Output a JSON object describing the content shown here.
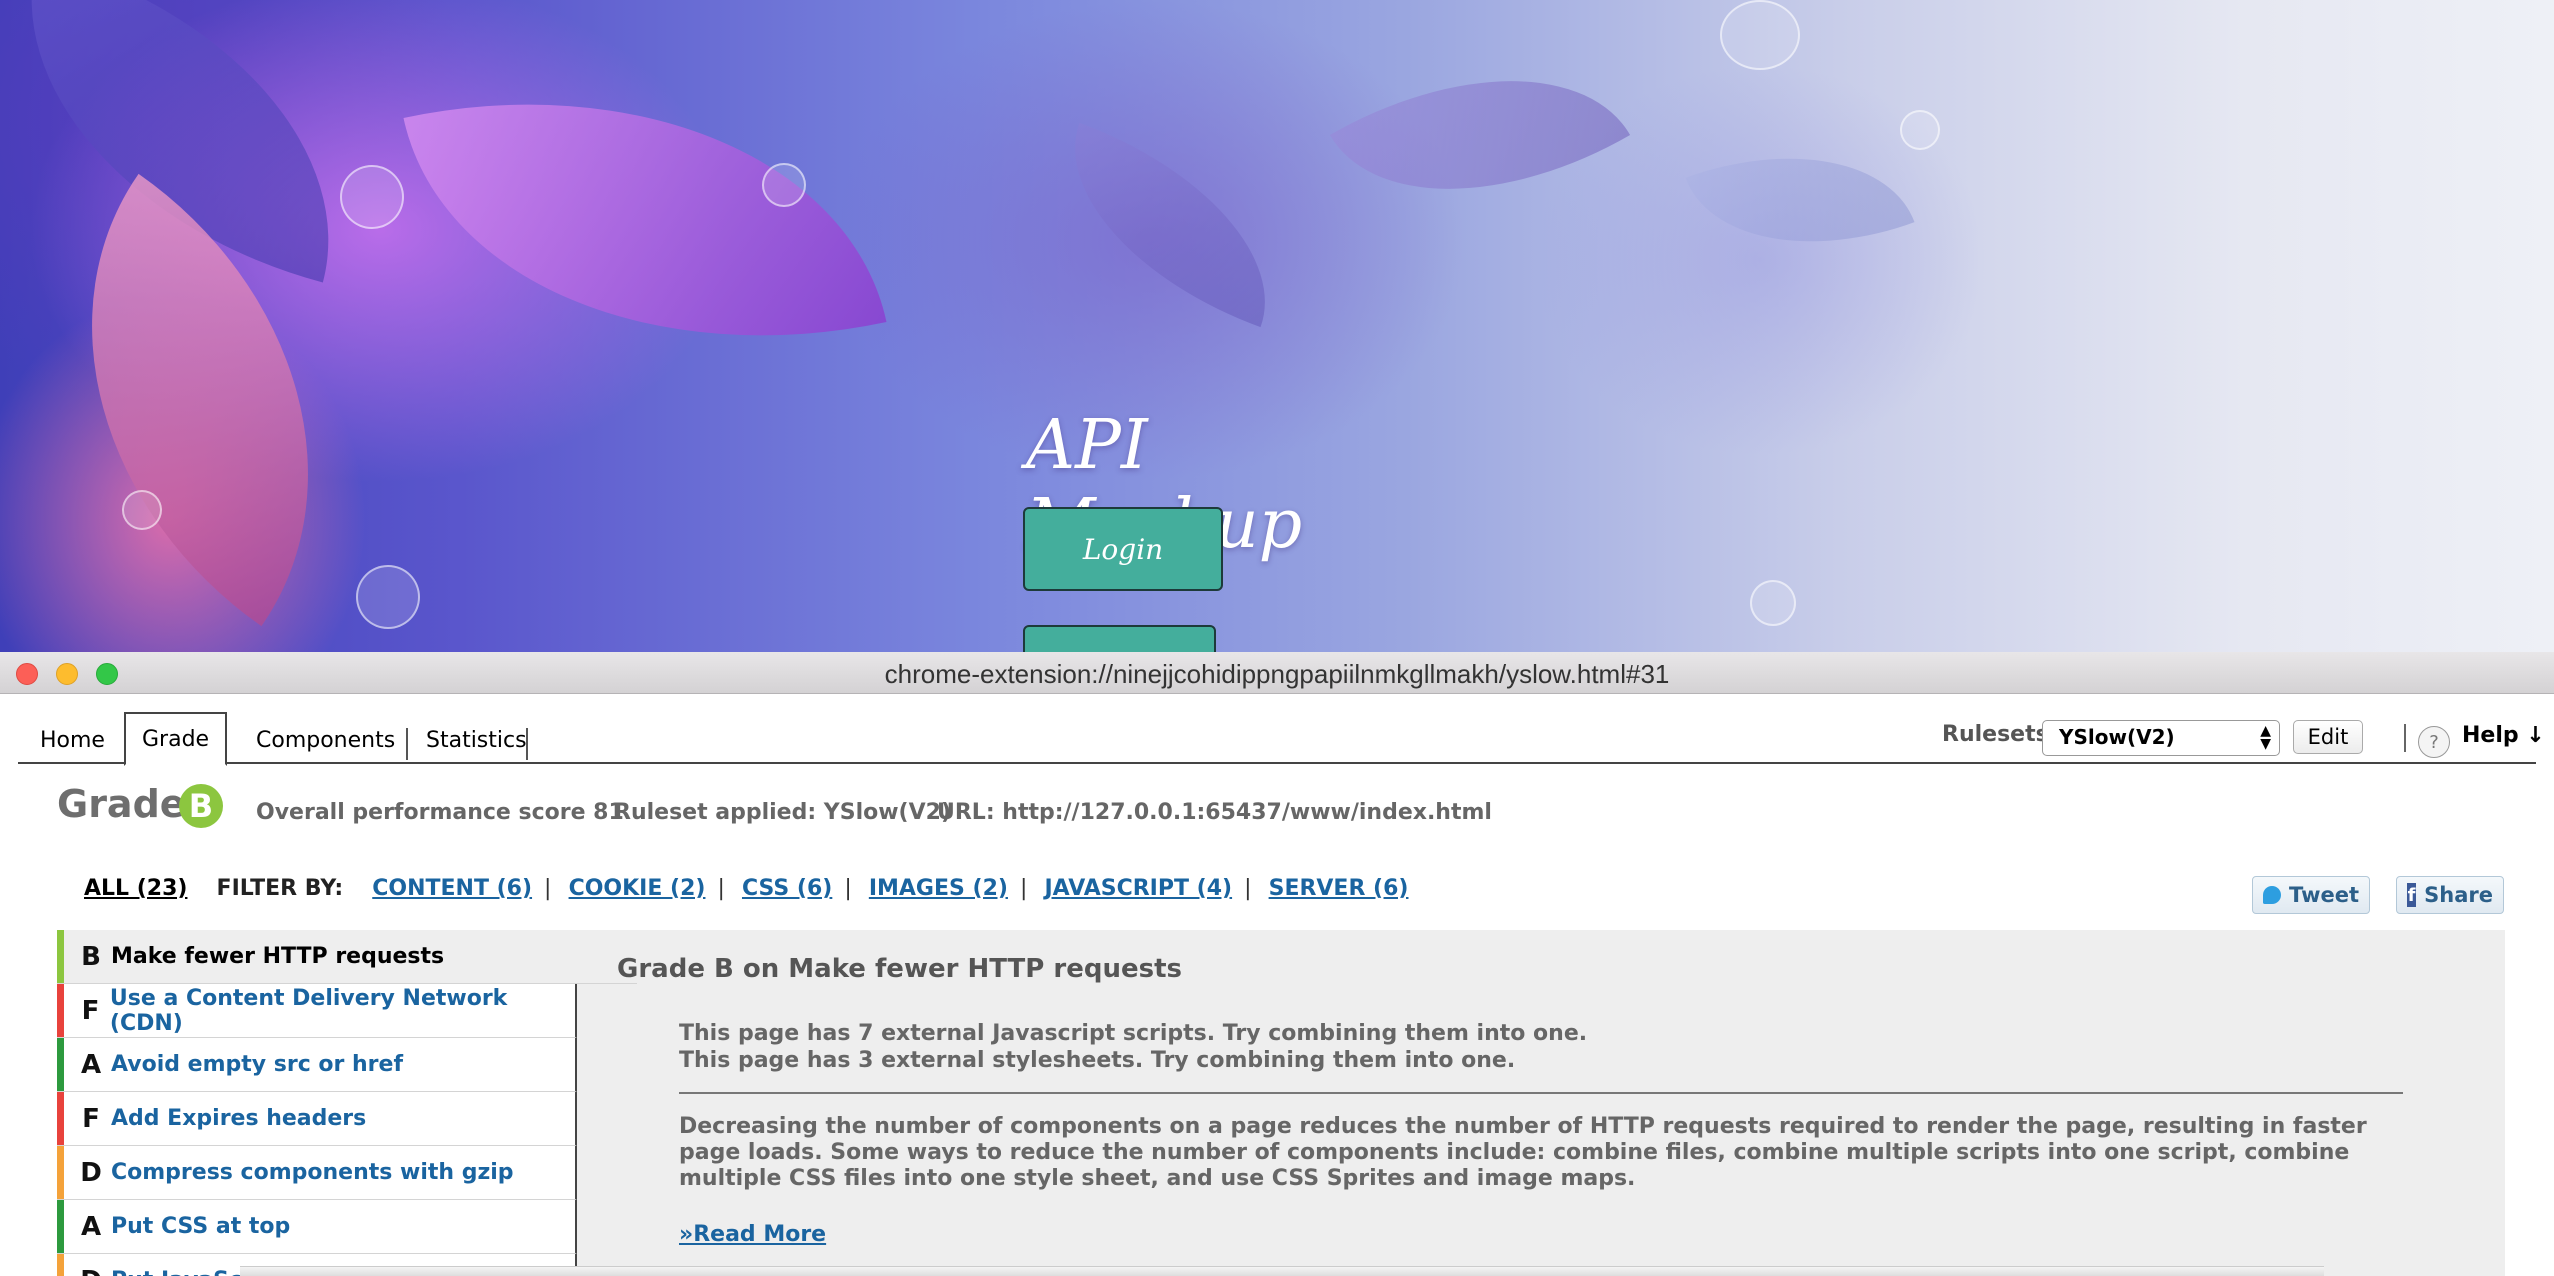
{
  "background_page": {
    "title": "API Mashup",
    "login_label": "Login"
  },
  "window": {
    "url": "chrome-extension://ninejjcohidippngpapiilnmkgllmakh/yslow.html#31"
  },
  "tabs": [
    "Home",
    "Grade",
    "Components",
    "Statistics"
  ],
  "toolbar": {
    "rulesets_label": "Rulesets",
    "ruleset_value": "YSlow(V2)",
    "edit_label": "Edit",
    "help_icon": "?",
    "help_label": "Help ↓"
  },
  "summary": {
    "grade_label": "Grade",
    "grade": "B",
    "score_text": "Overall performance score 81",
    "ruleset_text": "Ruleset applied: YSlow(V2)",
    "url_text": "URL: http://127.0.0.1:65437/www/index.html"
  },
  "filters": {
    "all": "ALL (23)",
    "label": "FILTER BY:",
    "items": [
      "CONTENT (6)",
      "COOKIE (2)",
      "CSS (6)",
      "IMAGES (2)",
      "JAVASCRIPT (4)",
      "SERVER (6)"
    ]
  },
  "share": {
    "tweet": "Tweet",
    "share": "Share"
  },
  "rules": [
    {
      "grade": "B",
      "name": "Make fewer HTTP requests",
      "color": "#8cc63f"
    },
    {
      "grade": "F",
      "name": "Use a Content Delivery Network (CDN)",
      "color": "#e8423c"
    },
    {
      "grade": "A",
      "name": "Avoid empty src or href",
      "color": "#2d9a3e"
    },
    {
      "grade": "F",
      "name": "Add Expires headers",
      "color": "#e8423c"
    },
    {
      "grade": "D",
      "name": "Compress components with gzip",
      "color": "#f4a23a"
    },
    {
      "grade": "A",
      "name": "Put CSS at top",
      "color": "#2d9a3e"
    },
    {
      "grade": "D",
      "name": "Put JavaScript at bottom",
      "color": "#f4a23a"
    }
  ],
  "detail": {
    "title": "Grade B on Make fewer HTTP requests",
    "message_1": "This page has 7 external Javascript scripts. Try combining them into one.",
    "message_2": "This page has 3 external stylesheets. Try combining them into one.",
    "description": "Decreasing the number of components on a page reduces the number of HTTP requests required to render the page, resulting in faster page loads. Some ways to reduce the number of components include: combine files, combine multiple scripts into one script, combine multiple CSS files into one style sheet, and use CSS Sprites and image maps.",
    "read_more": "»Read More"
  }
}
